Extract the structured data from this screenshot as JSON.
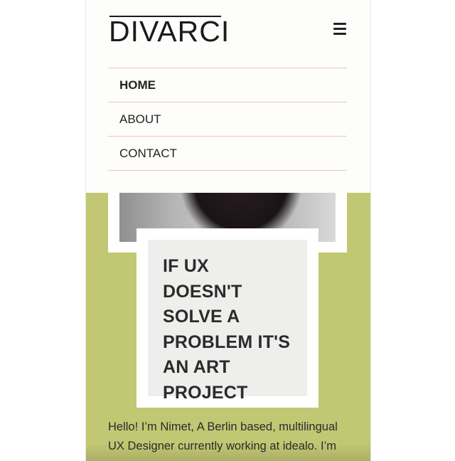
{
  "header": {
    "logo_text": "DIVARCI",
    "menu_icon": "hamburger-menu-icon"
  },
  "nav": {
    "items": [
      {
        "label": "HOME",
        "active": true
      },
      {
        "label": "ABOUT",
        "active": false
      },
      {
        "label": "CONTACT",
        "active": false
      }
    ]
  },
  "hero": {
    "quote": "IF UX DOESN'T SOLVE A PROBLEM IT'S AN ART PROJECT",
    "accent_color": "#c2c773",
    "intro": "Hello! I’m Nimet, A Berlin based, multilingual UX Designer currently working at idealo. I’m"
  },
  "colors": {
    "divider": "#f0c4b5",
    "quote_background": "#eeefec"
  }
}
